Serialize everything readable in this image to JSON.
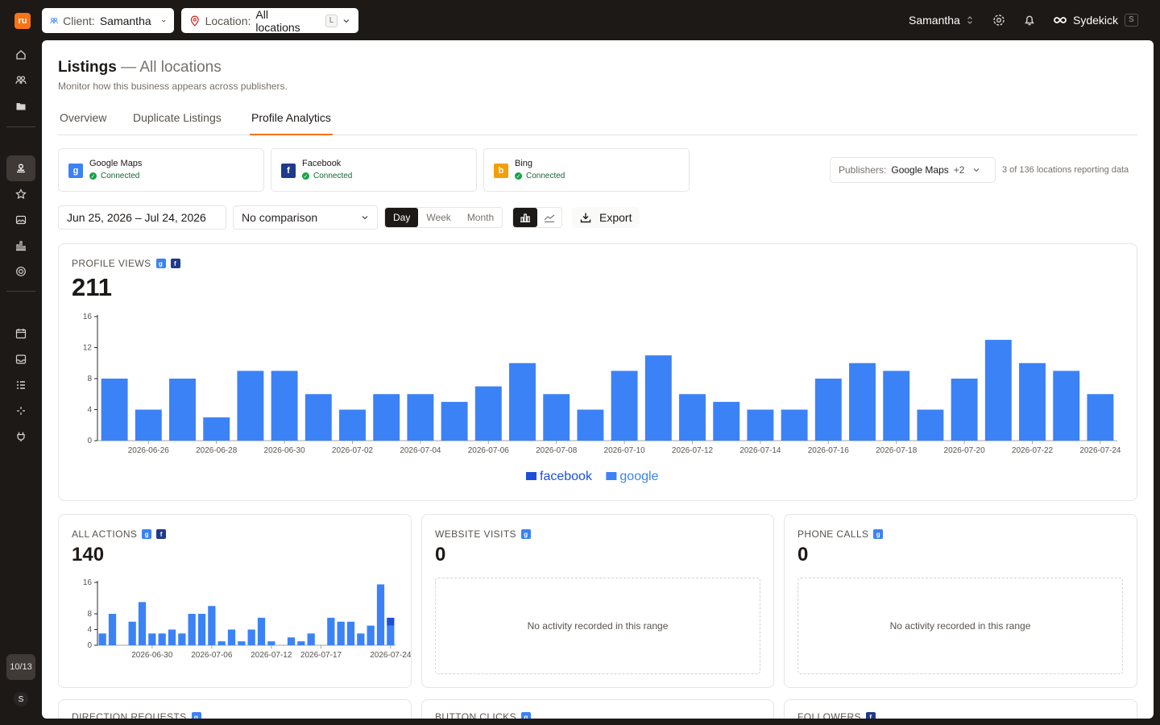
{
  "app": {
    "logo_text": "ru"
  },
  "topbar": {
    "client_label": "Client:",
    "client_value": "Samantha",
    "location_label": "Location:",
    "location_value": "All locations",
    "location_kbd": "L",
    "user_name": "Samantha",
    "assistant_name": "Sydekick",
    "assistant_kbd": "S"
  },
  "rail": {
    "count": "10/13",
    "avatar": "S"
  },
  "page": {
    "title": "Listings",
    "title_suffix": "— All locations",
    "subtitle": "Monitor how this business appears across publishers.",
    "tabs": [
      {
        "label": "Overview"
      },
      {
        "label": "Duplicate Listings"
      },
      {
        "label": "Profile Analytics"
      }
    ],
    "active_tab": "Profile Analytics"
  },
  "publishers": [
    {
      "name": "Google Maps",
      "status": "Connected",
      "icon": "google-maps-icon",
      "color": "#3b82f6"
    },
    {
      "name": "Facebook",
      "status": "Connected",
      "icon": "facebook-icon",
      "color": "#1e3a8a"
    },
    {
      "name": "Bing",
      "status": "Connected",
      "icon": "bing-icon",
      "color": "#f59e0b"
    }
  ],
  "publisher_select": {
    "label": "Publishers:",
    "value": "Google Maps",
    "extra": "+2"
  },
  "reporting_text": "3 of 136 locations reporting data",
  "controls": {
    "date_range": "Jun 25, 2026 – Jul 24, 2026",
    "comparison": "No comparison",
    "granularity": [
      "Day",
      "Week",
      "Month"
    ],
    "granularity_selected": "Day",
    "export_label": "Export"
  },
  "colors": {
    "google": "#3b82f6",
    "facebook": "#1d4ed8",
    "accent": "#f97316"
  },
  "profile_views": {
    "label": "PROFILE VIEWS",
    "value": "211"
  },
  "all_actions": {
    "label": "ALL ACTIONS",
    "value": "140"
  },
  "website_visits": {
    "label": "WEBSITE VISITS",
    "value": "0",
    "empty_text": "No activity recorded in this range"
  },
  "phone_calls": {
    "label": "PHONE CALLS",
    "value": "0",
    "empty_text": "No activity recorded in this range"
  },
  "bottom_cards": [
    {
      "label": "DIRECTION REQUESTS"
    },
    {
      "label": "BUTTON CLICKS"
    },
    {
      "label": "FOLLOWERS"
    }
  ],
  "chart_data": [
    {
      "type": "bar",
      "title": "PROFILE VIEWS",
      "x": [
        "2026-06-25",
        "2026-06-26",
        "2026-06-27",
        "2026-06-28",
        "2026-06-29",
        "2026-06-30",
        "2026-07-01",
        "2026-07-02",
        "2026-07-03",
        "2026-07-04",
        "2026-07-05",
        "2026-07-06",
        "2026-07-07",
        "2026-07-08",
        "2026-07-09",
        "2026-07-10",
        "2026-07-11",
        "2026-07-12",
        "2026-07-13",
        "2026-07-14",
        "2026-07-15",
        "2026-07-16",
        "2026-07-17",
        "2026-07-18",
        "2026-07-19",
        "2026-07-20",
        "2026-07-21",
        "2026-07-22",
        "2026-07-23",
        "2026-07-24"
      ],
      "x_ticks": [
        "2026-06-26",
        "2026-06-28",
        "2026-06-30",
        "2026-07-02",
        "2026-07-04",
        "2026-07-06",
        "2026-07-08",
        "2026-07-10",
        "2026-07-12",
        "2026-07-14",
        "2026-07-16",
        "2026-07-18",
        "2026-07-20",
        "2026-07-22",
        "2026-07-24"
      ],
      "series": [
        {
          "name": "facebook",
          "values": [
            0,
            0,
            0,
            0,
            0,
            0,
            0,
            0,
            0,
            0,
            0,
            0,
            0,
            0,
            0,
            0,
            0,
            0,
            0,
            0,
            0,
            0,
            0,
            0,
            0,
            0,
            0,
            0,
            0,
            0
          ]
        },
        {
          "name": "google",
          "values": [
            8,
            4,
            8,
            3,
            9,
            9,
            6,
            4,
            6,
            6,
            5,
            7,
            10,
            6,
            4,
            9,
            11,
            6,
            5,
            4,
            4,
            8,
            10,
            9,
            4,
            8,
            13,
            10,
            9,
            6
          ]
        }
      ],
      "ylim": [
        0,
        16
      ],
      "yticks": [
        0,
        4,
        8,
        12,
        16
      ],
      "stacked": true,
      "legend": "bottom-center"
    },
    {
      "type": "bar",
      "title": "ALL ACTIONS",
      "x": [
        "2026-06-25",
        "2026-06-26",
        "2026-06-27",
        "2026-06-28",
        "2026-06-29",
        "2026-06-30",
        "2026-07-01",
        "2026-07-02",
        "2026-07-03",
        "2026-07-04",
        "2026-07-05",
        "2026-07-06",
        "2026-07-07",
        "2026-07-08",
        "2026-07-09",
        "2026-07-10",
        "2026-07-11",
        "2026-07-12",
        "2026-07-13",
        "2026-07-14",
        "2026-07-15",
        "2026-07-16",
        "2026-07-17",
        "2026-07-18",
        "2026-07-19",
        "2026-07-20",
        "2026-07-21",
        "2026-07-22",
        "2026-07-23",
        "2026-07-24"
      ],
      "x_ticks": [
        "2026-06-30",
        "2026-07-06",
        "2026-07-12",
        "2026-07-17",
        "2026-07-24"
      ],
      "x_tick_index": [
        5,
        11,
        17,
        22,
        29
      ],
      "series": [
        {
          "name": "facebook",
          "values": [
            0,
            0,
            0,
            0,
            0,
            0,
            0,
            0,
            0,
            0,
            0,
            0,
            0,
            0,
            0,
            0,
            0,
            0,
            0,
            0,
            0,
            0,
            0,
            0,
            0,
            0,
            0,
            0,
            0,
            2
          ]
        },
        {
          "name": "google",
          "values": [
            3,
            8,
            0,
            6,
            11,
            3,
            3,
            4,
            3,
            8,
            8,
            10,
            1,
            4,
            1,
            4,
            7,
            1,
            0,
            2,
            1,
            3,
            0,
            7,
            6,
            6,
            3,
            5,
            15.5,
            5
          ]
        }
      ],
      "ylim": [
        0,
        16
      ],
      "yticks": [
        0,
        4,
        8,
        16
      ],
      "stacked": true
    }
  ]
}
